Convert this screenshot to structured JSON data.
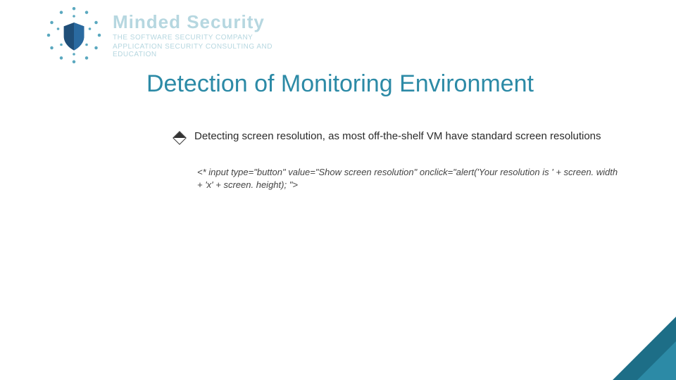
{
  "logo": {
    "brand": "Minded Security",
    "sub1": "THE SOFTWARE SECURITY COMPANY",
    "sub2": "APPLICATION SECURITY CONSULTING AND EDUCATION"
  },
  "title": "Detection of Monitoring Environment",
  "bullet": "Detecting screen resolution, as most off-the-shelf VM have standard screen resolutions",
  "code": "<* input type=\"button\" value=\"Show screen resolution\" onclick=\"alert('Your resolution is ' + screen. width + 'x' + screen. height); \">"
}
